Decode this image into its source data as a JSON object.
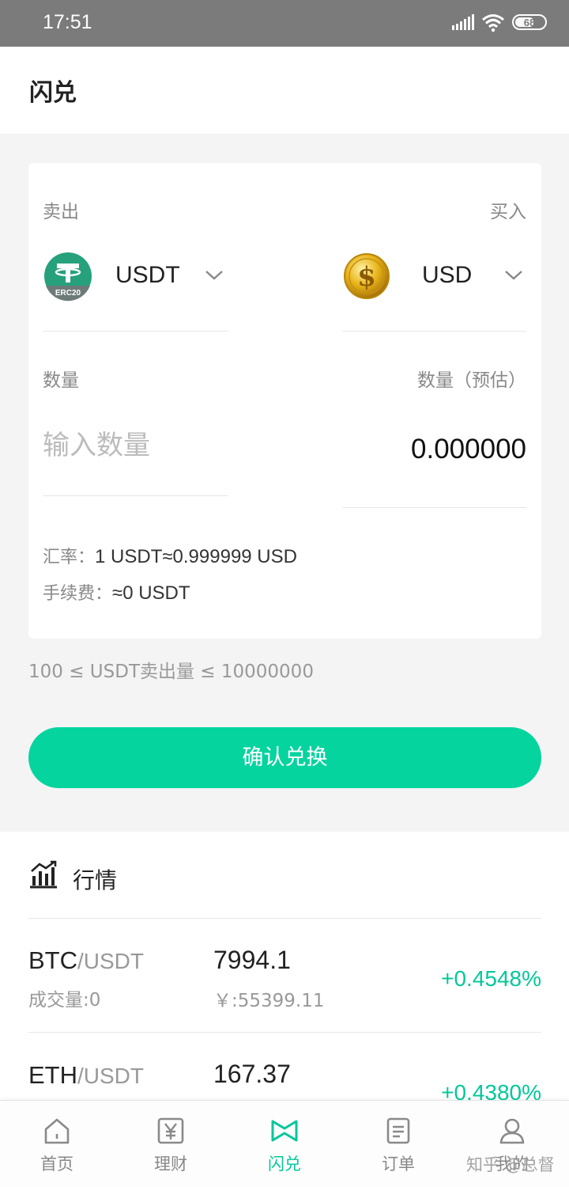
{
  "status_bar": {
    "time": "17:51",
    "battery": "68",
    "battery_level": 0.68
  },
  "header": {
    "title": "闪兑"
  },
  "exchange": {
    "sell_label": "卖出",
    "buy_label": "买入",
    "sell_coin": "USDT",
    "sell_coin_badge": "ERC20",
    "buy_coin": "USD",
    "qty_label": "数量",
    "qty_est_label": "数量（预估）",
    "input_placeholder": "输入数量",
    "output_value": "0.000000",
    "rate_key": "汇率：",
    "rate_value": "1 USDT≈0.999999 USD",
    "fee_key": "手续费：",
    "fee_value": "≈0 USDT"
  },
  "limit_text": "100 ≤ USDT卖出量 ≤ 10000000",
  "confirm_label": "确认兑换",
  "market": {
    "title": "行情",
    "rows": [
      {
        "base": "BTC",
        "quote": "/USDT",
        "volume": "成交量:0",
        "price": "7994.1",
        "cny": "￥:55399.11",
        "change": "+0.4548%"
      },
      {
        "base": "ETH",
        "quote": "/USDT",
        "volume": "",
        "price": "167.37",
        "cny": "",
        "change": "+0.4380%"
      }
    ]
  },
  "tabs": [
    {
      "label": "首页",
      "icon": "home-icon"
    },
    {
      "label": "理财",
      "icon": "yen-icon"
    },
    {
      "label": "闪兑",
      "icon": "exchange-icon"
    },
    {
      "label": "订单",
      "icon": "order-icon"
    },
    {
      "label": "我的",
      "icon": "user-icon"
    }
  ],
  "active_tab": 2,
  "watermark": "知乎 @总督",
  "colors": {
    "accent": "#05d49f",
    "positive": "#05c79a",
    "tether": "#26a17b",
    "statusbar": "#7b7b7b"
  }
}
